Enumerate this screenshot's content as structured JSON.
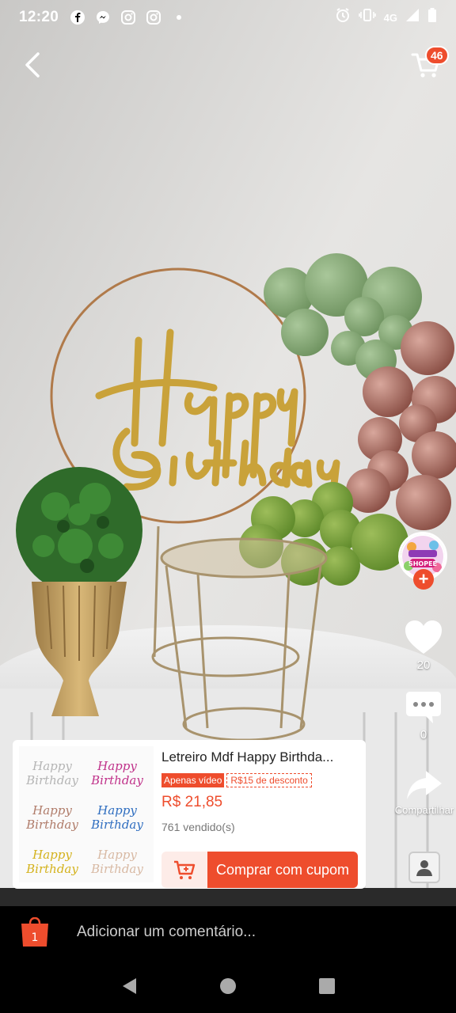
{
  "status_bar": {
    "time": "12:20",
    "network": "4G",
    "left_icons": [
      "facebook-icon",
      "messenger-icon",
      "instagram-icon",
      "instagram-icon",
      "dot-icon"
    ],
    "right_icons": [
      "alarm-icon",
      "vibrate-icon",
      "signal-icon",
      "battery-icon"
    ]
  },
  "top_nav": {
    "back_icon": "chevron-left-icon",
    "cart_icon": "cart-icon",
    "cart_count": "46"
  },
  "right_rail": {
    "creator_avatar_lettering": "ACHADINHOS DA SHOPEE",
    "likes": "20",
    "comments": "0",
    "share_label": "Compartilhar"
  },
  "video": {
    "sign_text": "Happy Birthday"
  },
  "product": {
    "title": "Letreiro Mdf Happy Birthda...",
    "promo_video": "Apenas vídeo",
    "promo_coupon": "R$15 de desconto",
    "price": "R$ 21,85",
    "sold": "761 vendido(s)",
    "buy_label": "Comprar com cupom",
    "thumb_variant_colors": [
      "#b5b5b5",
      "#c0328a",
      "#b07c6a",
      "#2f6ec0",
      "#d4b21c",
      "#d8b9a3"
    ],
    "thumb_text": "Happy Birthday"
  },
  "comment_bar": {
    "shopee_badge": "1",
    "placeholder": "Adicionar um comentário..."
  },
  "colors": {
    "accent": "#ee4d2d",
    "balloon_green": "#8aab79",
    "balloon_rose": "#a86a5e",
    "gold": "#c9a23a"
  }
}
